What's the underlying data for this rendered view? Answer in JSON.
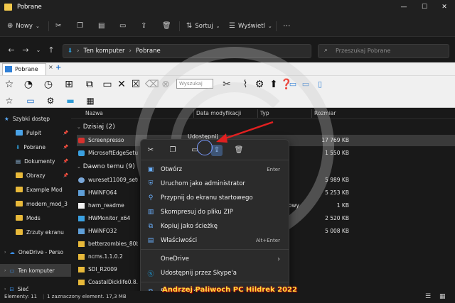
{
  "window": {
    "title": "Pobrane",
    "minimize": "—",
    "maximize": "☐",
    "close": "✕"
  },
  "command_bar": {
    "new_label": "Nowy",
    "sort_label": "Sortuj",
    "view_label": "Wyświetl",
    "more": "···"
  },
  "address": {
    "root": "Ten komputer",
    "current": "Pobrane",
    "search_placeholder": "Przeszukaj Pobrane"
  },
  "tab": {
    "label": "Pobrane",
    "close": "×",
    "add": "+"
  },
  "toolbar": {
    "search_placeholder": "Wyszukaj"
  },
  "sidebar": {
    "items": [
      {
        "label": "Szybki dostęp",
        "icon": "star-icon"
      },
      {
        "label": "Pulpit",
        "icon": "folder-icon",
        "pinned": true
      },
      {
        "label": "Pobrane",
        "icon": "download-icon",
        "pinned": true
      },
      {
        "label": "Dokumenty",
        "icon": "document-icon",
        "pinned": true
      },
      {
        "label": "Obrazy",
        "icon": "folder-icon",
        "pinned": true
      },
      {
        "label": "Example Mod",
        "icon": "folder-icon"
      },
      {
        "label": "modern_mod_3",
        "icon": "folder-icon"
      },
      {
        "label": "Mods",
        "icon": "folder-icon"
      },
      {
        "label": "Zrzuty ekranu",
        "icon": "folder-icon"
      },
      {
        "label": "OneDrive - Perso",
        "icon": "cloud-icon"
      },
      {
        "label": "Ten komputer",
        "icon": "monitor-icon"
      },
      {
        "label": "Sieć",
        "icon": "network-icon"
      }
    ]
  },
  "columns": {
    "name": "Nazwa",
    "modified": "Data modyfikacji",
    "type": "Typ",
    "size": "Rozmiar"
  },
  "groups": {
    "today": "Dzisiaj (2)",
    "earlier": "Dawno temu (9)"
  },
  "files_today": [
    {
      "name": "Screenpresso",
      "size": "17 769 KB",
      "type": ""
    },
    {
      "name": "MicrosoftEdgeSetup",
      "size": "1 550 KB",
      "type": ""
    }
  ],
  "files_earlier": [
    {
      "name": "wureset11009_setup_",
      "size": "5 989 KB",
      "type": ""
    },
    {
      "name": "HWiNFO64",
      "size": "5 253 KB",
      "type": ""
    },
    {
      "name": "hwm_readme",
      "size": "1 KB",
      "type": "ekstowy"
    },
    {
      "name": "HWMonitor_x64",
      "size": "2 520 KB",
      "type": ""
    },
    {
      "name": "HWiNFO32",
      "size": "5 008 KB",
      "type": ""
    },
    {
      "name": "betterzombies_80b06",
      "size": "",
      "type": ""
    },
    {
      "name": "ncms.1.1.0.2",
      "size": "",
      "type": ""
    },
    {
      "name": "SDI_R2009",
      "size": "",
      "type": ""
    },
    {
      "name": "CoastalDicklife0.8.9",
      "size": "",
      "type": ""
    }
  ],
  "context_menu": {
    "share_tooltip": "Udostępnij",
    "items": [
      {
        "label": "Otwórz",
        "shortcut": "Enter"
      },
      {
        "label": "Uruchom jako administrator",
        "shortcut": ""
      },
      {
        "label": "Przypnij do ekranu startowego",
        "shortcut": ""
      },
      {
        "label": "Skompresuj do pliku ZIP",
        "shortcut": ""
      },
      {
        "label": "Kopiuj jako ścieżkę",
        "shortcut": ""
      },
      {
        "label": "Właściwości",
        "shortcut": "Alt+Enter"
      },
      {
        "label": "OneDrive",
        "shortcut": "›"
      },
      {
        "label": "Udostępnij przez Skype'a",
        "shortcut": ""
      },
      {
        "label": "Pokaż więcej opcji",
        "shortcut": ""
      }
    ]
  },
  "status": {
    "elements": "Elementy: 11",
    "selection": "1 zaznaczony element. 17,3 MB"
  },
  "overlay": {
    "text": "Andrzej Paliwoch PC Hildrek 2022"
  },
  "colors": {
    "accent": "#6ab0ff",
    "folder": "#e8b93a",
    "arrow": "#e02020"
  }
}
